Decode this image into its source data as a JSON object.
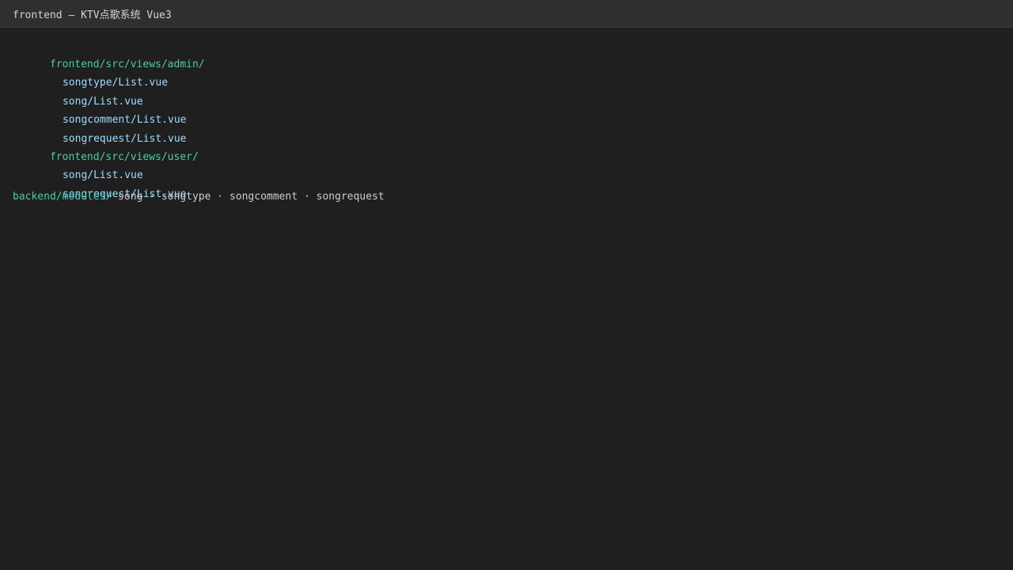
{
  "window": {
    "title": "frontend — KTV点歌系统 Vue3"
  },
  "tree": {
    "admin_dir": "frontend/src/views/admin/",
    "admin_files": [
      "songtype/List.vue",
      "song/List.vue",
      "songcomment/List.vue",
      "songrequest/List.vue"
    ],
    "user_dir": "frontend/src/views/user/",
    "user_files": [
      "song/List.vue",
      "songrequest/List.vue"
    ],
    "backend_dir": "backend/modules/",
    "backend_modules": " song · songtype · songcomment · songrequest"
  },
  "colors": {
    "background": "#1f1f1f",
    "titlebar": "#2f2f2f",
    "directory": "#4ec9b0",
    "file": "#9cdcfe",
    "text": "#cccccc"
  }
}
